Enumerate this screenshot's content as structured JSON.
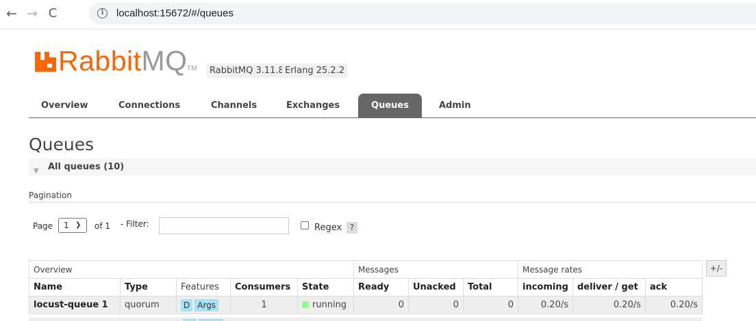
{
  "browser": {
    "url": "localhost:15672/#/queues",
    "back_icon": "←",
    "forward_icon": "→",
    "reload_icon": "C"
  },
  "header": {
    "logo_rabbit": "Rabbit",
    "logo_mq": "MQ",
    "logo_tm": "TM",
    "version": "RabbitMQ 3.11.8",
    "erlang": "Erlang 25.2.2",
    "brand_color": "#ff6600"
  },
  "tabs": [
    {
      "label": "Overview",
      "active": false
    },
    {
      "label": "Connections",
      "active": false
    },
    {
      "label": "Channels",
      "active": false
    },
    {
      "label": "Exchanges",
      "active": false
    },
    {
      "label": "Queues",
      "active": true
    },
    {
      "label": "Admin",
      "active": false
    }
  ],
  "page": {
    "title": "Queues",
    "section": "All queues (10)",
    "pagination_label": "Pagination"
  },
  "pagination": {
    "page_label": "Page",
    "page_value": "1",
    "of_label": "of 1",
    "filter_label": "- Filter:",
    "filter_value": "",
    "regex_label": "Regex",
    "regex_checked": false,
    "help": "?"
  },
  "table": {
    "groups": [
      "Overview",
      "Messages",
      "Message rates"
    ],
    "plusminus": "+/-",
    "columns": [
      "Name",
      "Type",
      "Features",
      "Consumers",
      "State",
      "Ready",
      "Unacked",
      "Total",
      "incoming",
      "deliver / get",
      "ack"
    ],
    "rows": [
      {
        "name": "locust-queue 1",
        "type": "quorum",
        "features": [
          "D",
          "Args"
        ],
        "consumers": "1",
        "state": "running",
        "ready": "0",
        "unacked": "0",
        "total": "0",
        "incoming": "0.20/s",
        "deliver_get": "0.20/s",
        "ack": "0.20/s"
      }
    ]
  },
  "colors": {
    "active_tab": "#666666",
    "feature_badge": "#a5e2f2",
    "running": "#98f898"
  }
}
